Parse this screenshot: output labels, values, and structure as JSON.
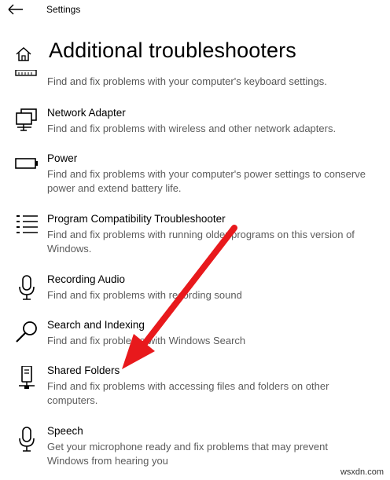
{
  "window": {
    "title": "Settings"
  },
  "page": {
    "title": "Additional troubleshooters"
  },
  "partial_item": {
    "description": "Find and fix problems with your computer's keyboard settings."
  },
  "items": [
    {
      "icon": "network-adapter-icon",
      "title": "Network Adapter",
      "description": "Find and fix problems with wireless and other network adapters."
    },
    {
      "icon": "battery-icon",
      "title": "Power",
      "description": "Find and fix problems with your computer's power settings to conserve power and extend battery life."
    },
    {
      "icon": "list-icon",
      "title": "Program Compatibility Troubleshooter",
      "description": "Find and fix problems with running older programs on this version of Windows."
    },
    {
      "icon": "microphone-icon",
      "title": "Recording Audio",
      "description": "Find and fix problems with recording sound"
    },
    {
      "icon": "search-icon",
      "title": "Search and Indexing",
      "description": "Find and fix problems with Windows Search"
    },
    {
      "icon": "shared-folders-icon",
      "title": "Shared Folders",
      "description": "Find and fix problems with accessing files and folders on other computers."
    },
    {
      "icon": "microphone-icon",
      "title": "Speech",
      "description": "Get your microphone ready and fix problems that may prevent Windows from hearing you"
    }
  ],
  "annotation": {
    "arrow_color": "#e8191c",
    "points_to": "Shared Folders"
  },
  "watermark": "wsxdn.com"
}
